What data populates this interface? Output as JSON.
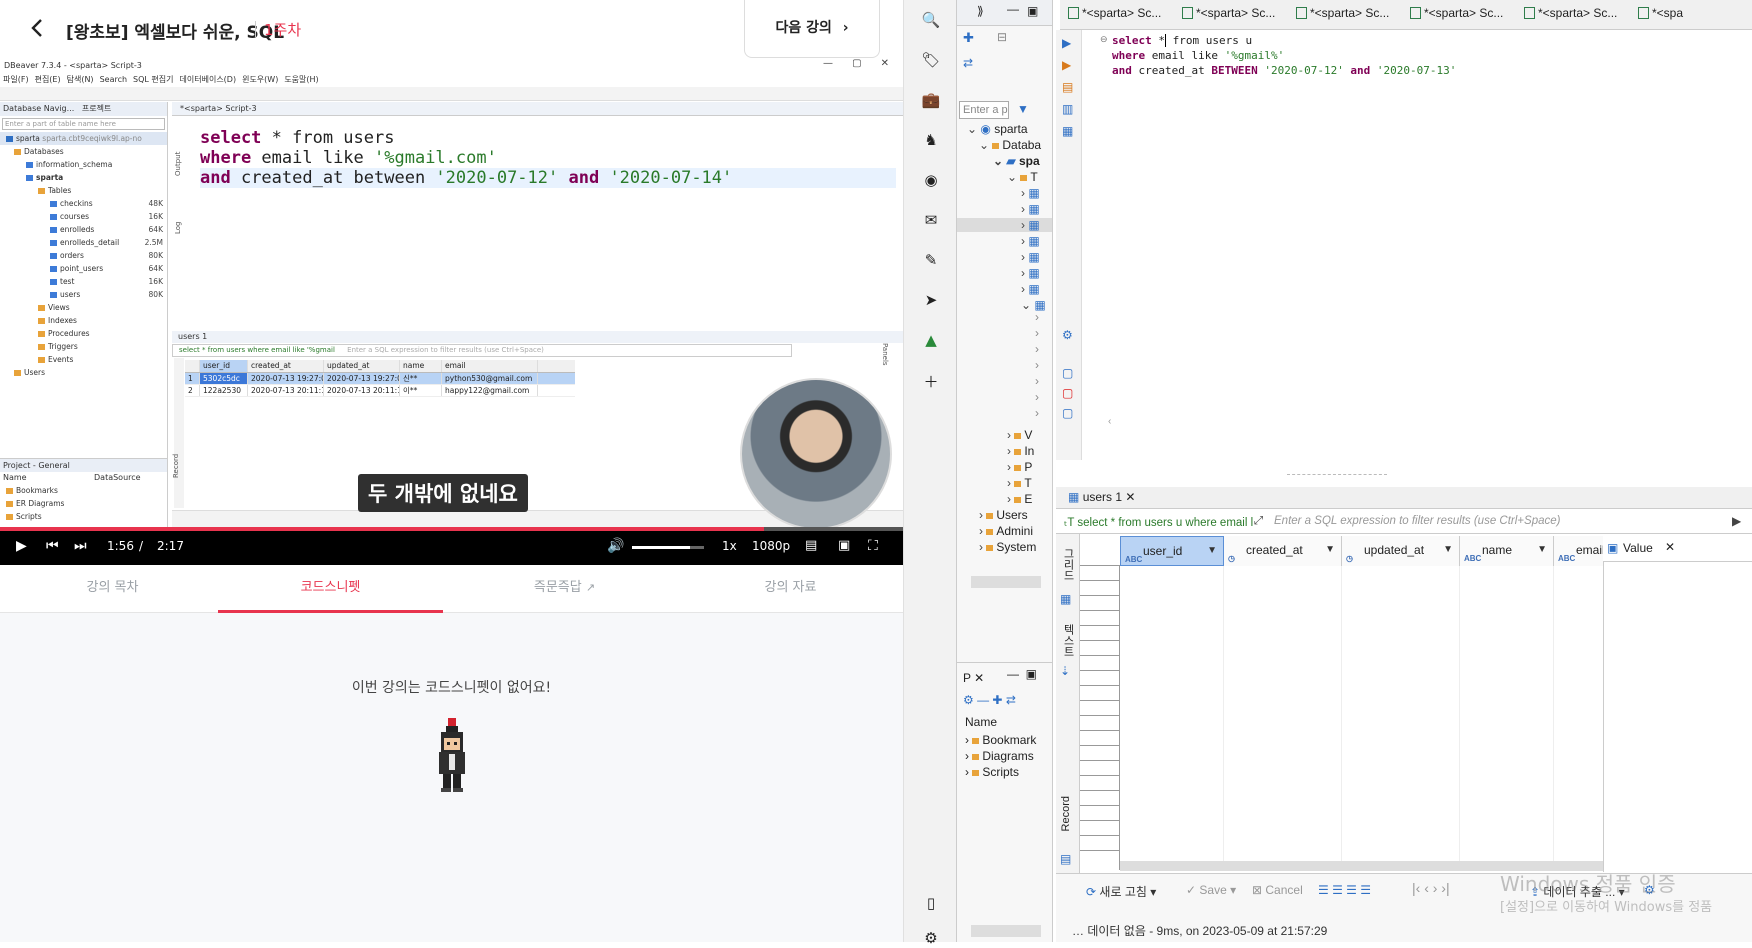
{
  "lecture": {
    "title": "[왕초보] 엑셀보다 쉬운, SQL",
    "week": "1주차",
    "next_label": "다음 강의",
    "back_icon": "‹",
    "subtitle": "두 개밖에 없네요",
    "player": {
      "current_time": "1:56",
      "separator": "/",
      "total_time": "2:17",
      "progress": 0.846,
      "volume": 0.8,
      "speed": "1x",
      "quality": "1080p"
    },
    "tabs": [
      "강의 목차",
      "코드스니펫",
      "즉문즉답",
      "강의 자료"
    ],
    "active_tab": "코드스니펫",
    "empty_message": "이번 강의는 코드스니펫이 없어요!",
    "accent_color": "#e8344e"
  },
  "video_dbeaver": {
    "title": "DBeaver 7.3.4 - <sparta> Script-3",
    "menu": [
      "파일(F)",
      "편집(E)",
      "탐색(N)",
      "Search",
      "SQL 편집기",
      "데이터베이스(D)",
      "윈도우(W)",
      "도움말(H)"
    ],
    "nav_header": "Database Navig...",
    "nav_header2": "프로젝트",
    "filter_placeholder": "Enter a part of table name here",
    "connection": "sparta",
    "connection_host": "sparta.cbt9ceqiwk9l.ap-no",
    "databases": "Databases",
    "schema1": "information_schema",
    "schema2": "sparta",
    "tables_folder": "Tables",
    "tables": [
      {
        "name": "checkins",
        "size": "48K"
      },
      {
        "name": "courses",
        "size": "16K"
      },
      {
        "name": "enrolleds",
        "size": "64K"
      },
      {
        "name": "enrolleds_detail",
        "size": "2.5M"
      },
      {
        "name": "orders",
        "size": "80K"
      },
      {
        "name": "point_users",
        "size": "64K"
      },
      {
        "name": "test",
        "size": "16K"
      },
      {
        "name": "users",
        "size": "80K"
      }
    ],
    "folders": [
      "Views",
      "Indexes",
      "Procedures",
      "Triggers",
      "Events"
    ],
    "users_folder": "Users",
    "project_title": "Project - General",
    "project_cols": [
      "Name",
      "DataSource"
    ],
    "project_items": [
      "Bookmarks",
      "ER Diagrams",
      "Scripts"
    ],
    "editor_tab": "*<sparta> Script-3",
    "sql_line1_kw": "select",
    "sql_line1_rest": " * from users",
    "sql_line2_kw": "where",
    "sql_line2_rest": " email like ",
    "sql_line2_str": "'%gmail.com'",
    "sql_line3_kw": "and",
    "sql_line3_rest": " created_at between ",
    "sql_line3_str1": "'2020-07-12'",
    "sql_line3_mid": " and ",
    "sql_line3_str2": "'2020-07-14'",
    "results_tab": "users 1",
    "results_filter": "select * from users where email like '%gmail",
    "results_filter_hint": "Enter a SQL expression to filter results (use Ctrl+Space)",
    "columns": [
      "user_id",
      "created_at",
      "updated_at",
      "name",
      "email"
    ],
    "rows": [
      [
        "1",
        "5302c5dc",
        "2020-07-13 19:27:09",
        "2020-07-13 19:27:09",
        "신**",
        "python530@gmail.com"
      ],
      [
        "2",
        "122a2530",
        "2020-07-13 20:11:13",
        "2020-07-13 20:11:13",
        "이**",
        "happy122@gmail.com"
      ]
    ],
    "side_labels": [
      "Output",
      "Log",
      "Record",
      "Panels"
    ]
  },
  "dock": {
    "icons": [
      "search-icon",
      "tag-icon",
      "briefcase-icon",
      "chess-icon",
      "copilot-icon",
      "outlook-icon",
      "edit-icon",
      "send-icon",
      "tree-icon",
      "plus-icon",
      "sidebar-icon",
      "gear-icon"
    ]
  },
  "dbeaver": {
    "editor_tabs": [
      "*<sparta> Sc...",
      "*<sparta> Sc...",
      "*<sparta> Sc...",
      "*<sparta> Sc...",
      "*<sparta> Sc...",
      "*<spa"
    ],
    "nav_filter_placeholder": "Enter a p",
    "nav_items": [
      "sparta",
      "Databa",
      "spa",
      "T",
      "V",
      "In",
      "P",
      "T",
      "E",
      "Users",
      "Admini",
      "System"
    ],
    "sql_kw1": "select",
    "sql_rest1": " *",
    "sql_rest1b": " from users u",
    "sql_kw2": "where",
    "sql_rest2": " email like ",
    "sql_str2": "'%gmail%'",
    "sql_kw3": "and",
    "sql_rest3": " created_at ",
    "sql_kw3b": "BETWEEN",
    "sql_str3a": " '2020-07-12'",
    "sql_kw3c": " and",
    "sql_str3b": " '2020-07-13'",
    "results_tab": "users 1",
    "filter_query": "select * from users u where email l",
    "filter_hint": "Enter a SQL expression to filter results (use Ctrl+Space)",
    "columns": [
      "user_id",
      "created_at",
      "updated_at",
      "name",
      "email"
    ],
    "value_panel": "Value",
    "side_labels": [
      "그리드",
      "텍스트",
      "Record"
    ],
    "project_label": "P",
    "project_name_header": "Name",
    "project_items": [
      "Bookmark",
      "Diagrams",
      "Scripts"
    ],
    "refresh": "새로 고침",
    "save": "Save",
    "cancel": "Cancel",
    "export": "데이터 추출 ...",
    "status_msg": "데이터 없음 - 9ms, on 2023-05-09 at 21:57:29",
    "watermark": "Windows 정품 인증",
    "watermark2": "[설정]으로 이동하여 Windows를 정품"
  }
}
